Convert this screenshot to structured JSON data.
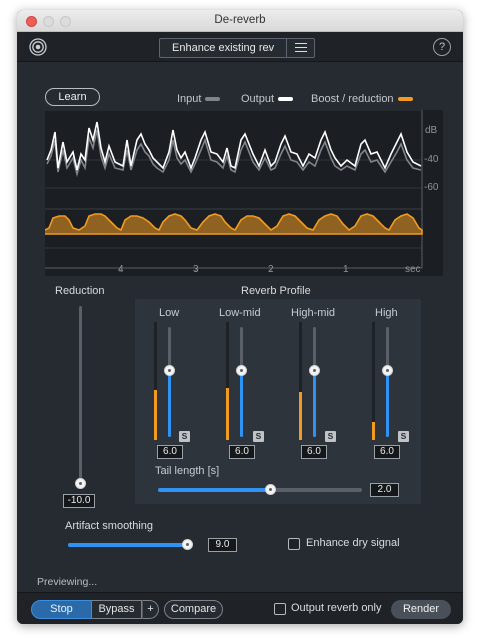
{
  "window": {
    "title": "De-reverb"
  },
  "header": {
    "preset_label": "Enhance existing rev",
    "help_label": "?"
  },
  "display": {
    "learn_label": "Learn",
    "legend": [
      {
        "label": "Input",
        "color": "#7f858c"
      },
      {
        "label": "Output",
        "color": "#ffffff"
      },
      {
        "label": "Boost / reduction",
        "color": "#f19b21"
      }
    ],
    "db_labels": [
      "dB",
      "-40",
      "-60"
    ],
    "time_labels": [
      "4",
      "3",
      "2",
      "1",
      "sec"
    ]
  },
  "reduction": {
    "label": "Reduction",
    "value": "-10.0",
    "level": 0
  },
  "reverb_profile": {
    "label": "Reverb Profile",
    "bands": [
      {
        "name": "Low",
        "value": "6.0",
        "solo": "S"
      },
      {
        "name": "Low-mid",
        "value": "6.0",
        "solo": "S"
      },
      {
        "name": "High-mid",
        "value": "6.0",
        "solo": "S"
      },
      {
        "name": "High",
        "value": "6.0",
        "solo": "S"
      }
    ],
    "tail_length_label": "Tail length [s]",
    "tail_length_value": "2.0"
  },
  "artifact_smoothing": {
    "label": "Artifact smoothing",
    "value": "9.0"
  },
  "enhance_dry": {
    "label": "Enhance dry signal",
    "checked": false
  },
  "status": {
    "text": "Previewing..."
  },
  "footer": {
    "stop_label": "Stop",
    "bypass_label": "Bypass",
    "plus_label": "+",
    "compare_label": "Compare",
    "output_reverb_only_label": "Output reverb only",
    "render_label": "Render"
  },
  "colors": {
    "accent_blue": "#2e93f2",
    "accent_orange": "#f19b21",
    "background": "#262b31"
  }
}
